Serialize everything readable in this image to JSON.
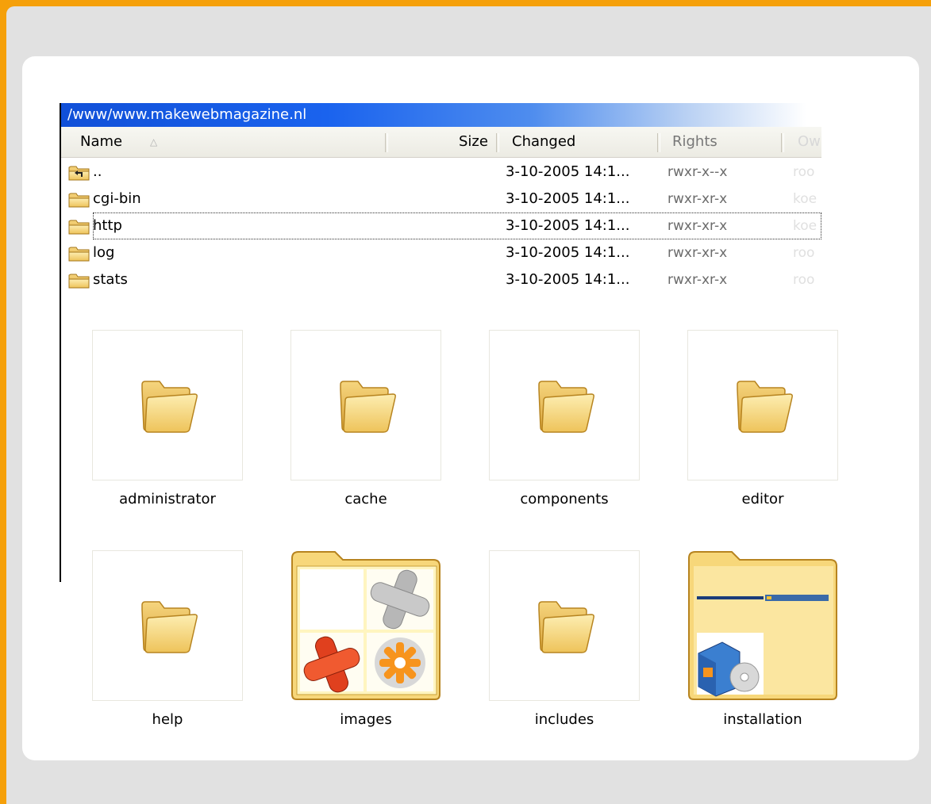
{
  "window": {
    "path": "/www/www.makewebmagazine.nl"
  },
  "columns": {
    "name": "Name",
    "size": "Size",
    "changed": "Changed",
    "rights": "Rights",
    "owner": "Ow"
  },
  "files": [
    {
      "name": "..",
      "icon": "parent-folder-icon",
      "changed": "3-10-2005 14:1...",
      "rights": "rwxr-x--x",
      "owner": "roo"
    },
    {
      "name": "cgi-bin",
      "icon": "folder-icon",
      "changed": "3-10-2005 14:1...",
      "rights": "rwxr-xr-x",
      "owner": "koe"
    },
    {
      "name": "http",
      "icon": "folder-icon",
      "changed": "3-10-2005 14:1...",
      "rights": "rwxr-xr-x",
      "owner": "koe"
    },
    {
      "name": "log",
      "icon": "folder-icon",
      "changed": "3-10-2005 14:1...",
      "rights": "rwxr-xr-x",
      "owner": "roo"
    },
    {
      "name": "stats",
      "icon": "folder-icon",
      "changed": "3-10-2005 14:1...",
      "rights": "rwxr-xr-x",
      "owner": "roo"
    }
  ],
  "thumbnails": [
    {
      "name": "administrator",
      "icon": "folder-icon"
    },
    {
      "name": "cache",
      "icon": "folder-icon"
    },
    {
      "name": "components",
      "icon": "folder-icon"
    },
    {
      "name": "editor",
      "icon": "folder-icon"
    },
    {
      "name": "help",
      "icon": "folder-icon"
    },
    {
      "name": "images",
      "icon": "image-folder-icon"
    },
    {
      "name": "includes",
      "icon": "folder-icon"
    },
    {
      "name": "installation",
      "icon": "install-folder-icon"
    }
  ],
  "colors": {
    "frame": "#f5a00a",
    "background": "#e1e1e1",
    "titlebar": "#1a63ee",
    "folder": "#f7d97e"
  }
}
